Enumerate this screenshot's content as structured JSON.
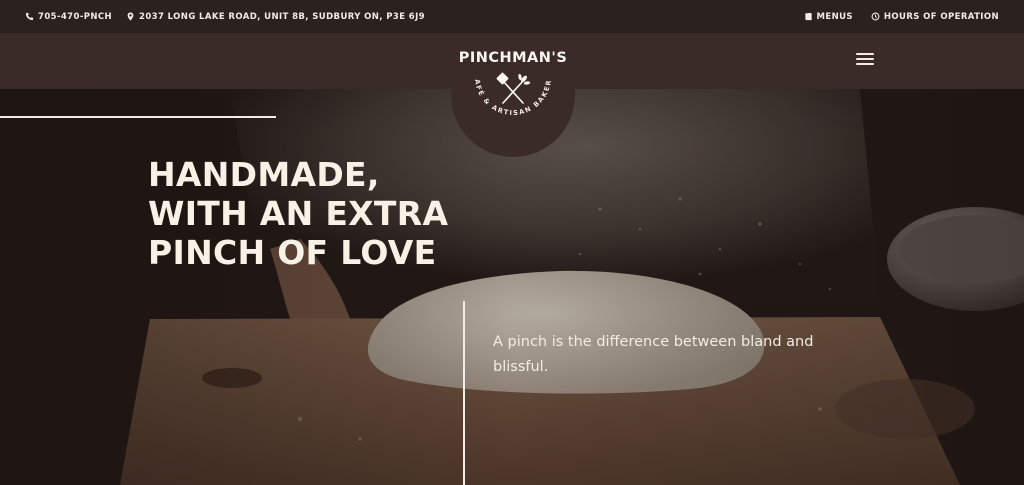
{
  "topbar": {
    "phone": "705-470-PNCH",
    "address": "2037 LONG LAKE ROAD, UNIT 8B, SUDBURY ON, P3E 6J9",
    "menus_label": "MENUS",
    "hours_label": "HOURS OF OPERATION",
    "icons": [
      "phone-icon",
      "location-pin-icon",
      "book-icon",
      "clock-icon"
    ]
  },
  "header": {
    "logo": {
      "brand": "PINCHMAN'S",
      "subtitle": "CAFÉ & ARTISAN BAKERY"
    },
    "menu_icon": "hamburger-menu-icon"
  },
  "hero": {
    "headline_lines": [
      "HANDMADE,",
      "WITH AN EXTRA",
      "PINCH OF LOVE"
    ],
    "tagline": "A pinch is the difference between bland and blissful."
  },
  "colors": {
    "topbar_bg": "#2b211e",
    "nav_bg": "#3a2b27",
    "text_cream": "#f7f1e6"
  }
}
